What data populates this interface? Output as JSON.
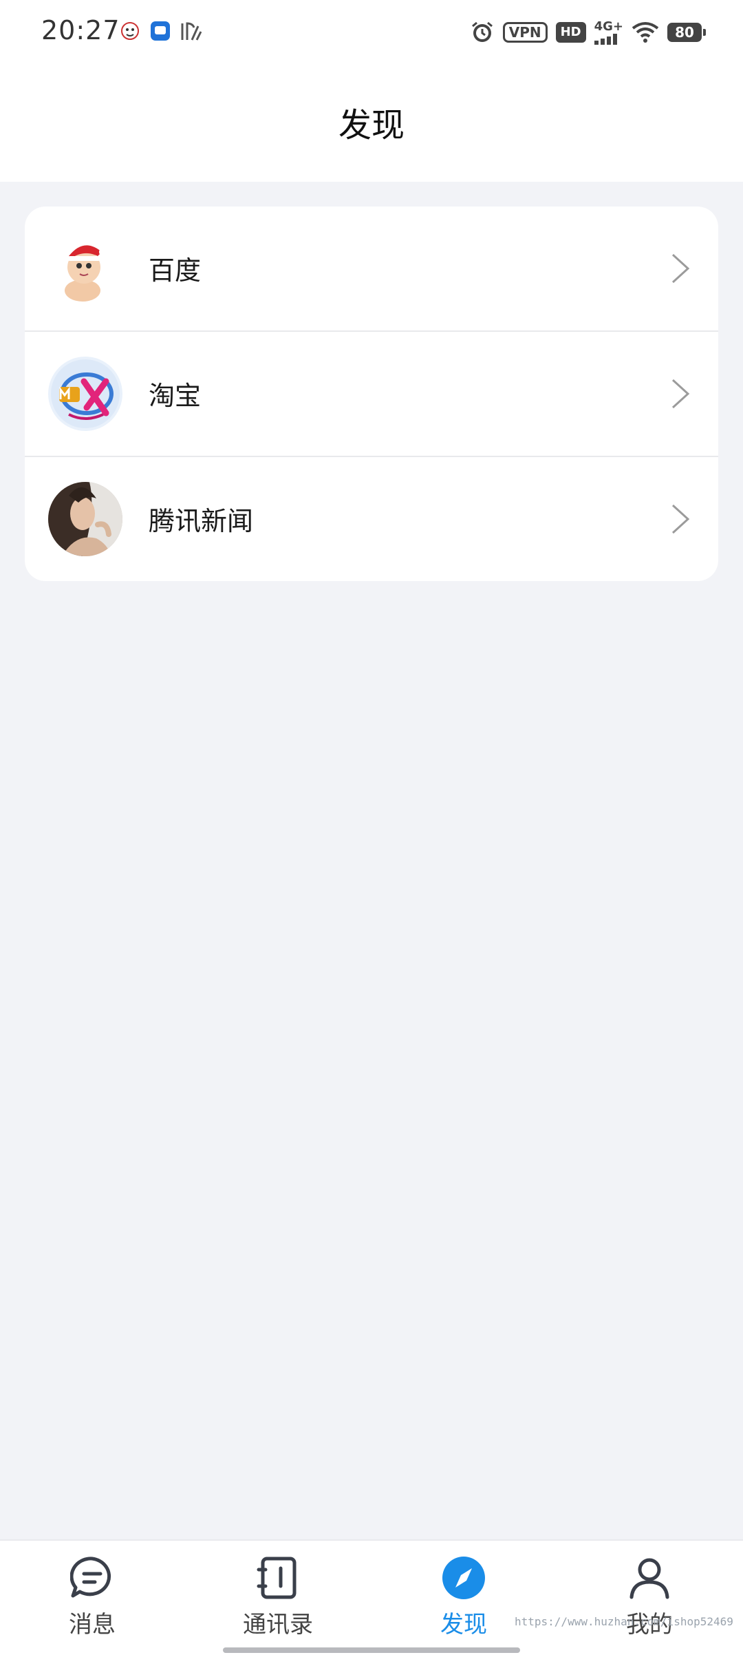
{
  "status_bar": {
    "time": "20:27",
    "vpn": "VPN",
    "hd": "HD",
    "network": "4G+",
    "battery": "80"
  },
  "header": {
    "title": "发现"
  },
  "discover": {
    "items": [
      {
        "label": "百度"
      },
      {
        "label": "淘宝"
      },
      {
        "label": "腾讯新闻"
      }
    ]
  },
  "tabs": [
    {
      "label": "消息",
      "icon": "chat-icon"
    },
    {
      "label": "通讯录",
      "icon": "contacts-icon"
    },
    {
      "label": "发现",
      "icon": "compass-icon",
      "active": true
    },
    {
      "label": "我的",
      "icon": "person-icon"
    }
  ],
  "watermark": "https://www.huzhan.com/ishop52469",
  "colors": {
    "accent": "#1a8de8",
    "background": "#f2f3f7"
  }
}
